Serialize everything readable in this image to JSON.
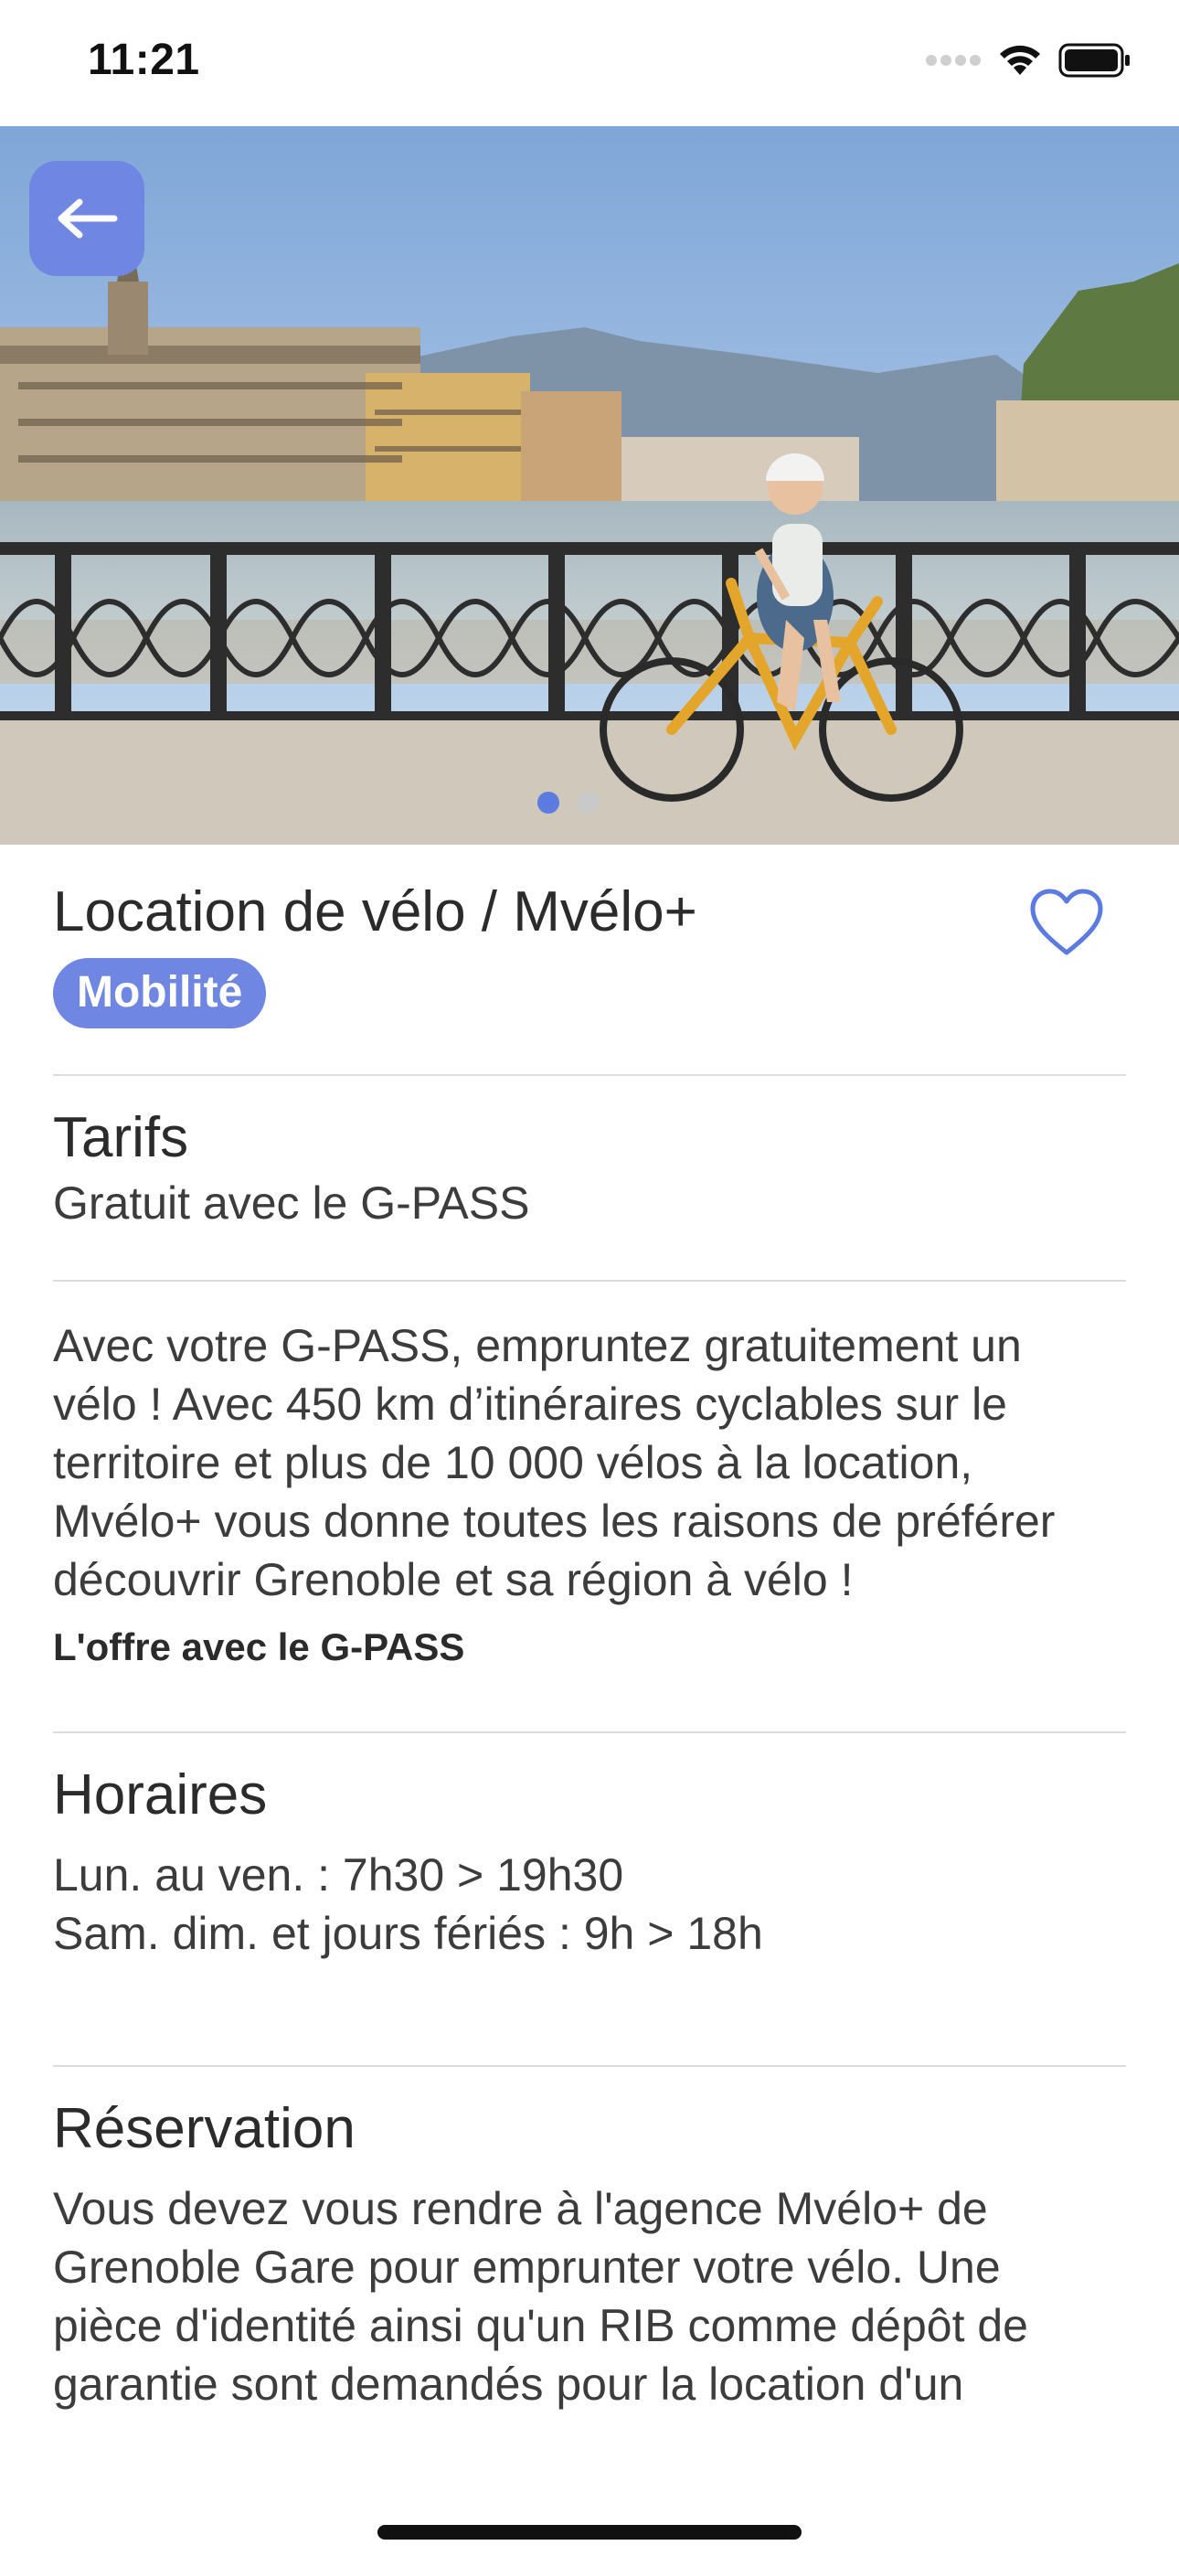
{
  "status_bar": {
    "time": "11:21"
  },
  "hero": {
    "image": "grenoble-bridge-cyclist-photo",
    "carousel_total": 2,
    "carousel_active": 1
  },
  "header": {
    "title": "Location de vélo / Mvélo+",
    "category_badge": "Mobilité",
    "favorite_icon": "heart-outline-icon",
    "back_icon": "arrow-left-icon"
  },
  "sections": {
    "tarifs": {
      "title": "Tarifs",
      "value": "Gratuit avec le G-PASS"
    },
    "description": {
      "lines": [
        "Avec votre G-PASS, empruntez gratuitement un",
        "vélo ! Avec 450 km d’itinéraires cyclables sur le",
        "territoire et plus de 10 000 vélos à la location,",
        "Mvélo+ vous donne toutes les raisons de préférer",
        "découvrir Grenoble et sa région à vélo !"
      ],
      "offer_link": "L'offre avec le G-PASS"
    },
    "horaires": {
      "title": "Horaires",
      "lines": [
        "Lun. au ven. : 7h30 > 19h30",
        "Sam. dim. et jours fériés : 9h > 18h"
      ]
    },
    "reservation": {
      "title": "Réservation",
      "lines": [
        "Vous devez vous rendre à l'agence Mvélo+ de",
        "Grenoble Gare pour emprunter votre vélo. Une",
        "pièce d'identité ainsi qu'un RIB comme dépôt de",
        "garantie sont demandés pour la location d'un"
      ]
    }
  },
  "colors": {
    "accent": "#6f87e3",
    "heart": "#5b7be0",
    "text": "#2b2b2b",
    "divider": "#dddddd"
  }
}
